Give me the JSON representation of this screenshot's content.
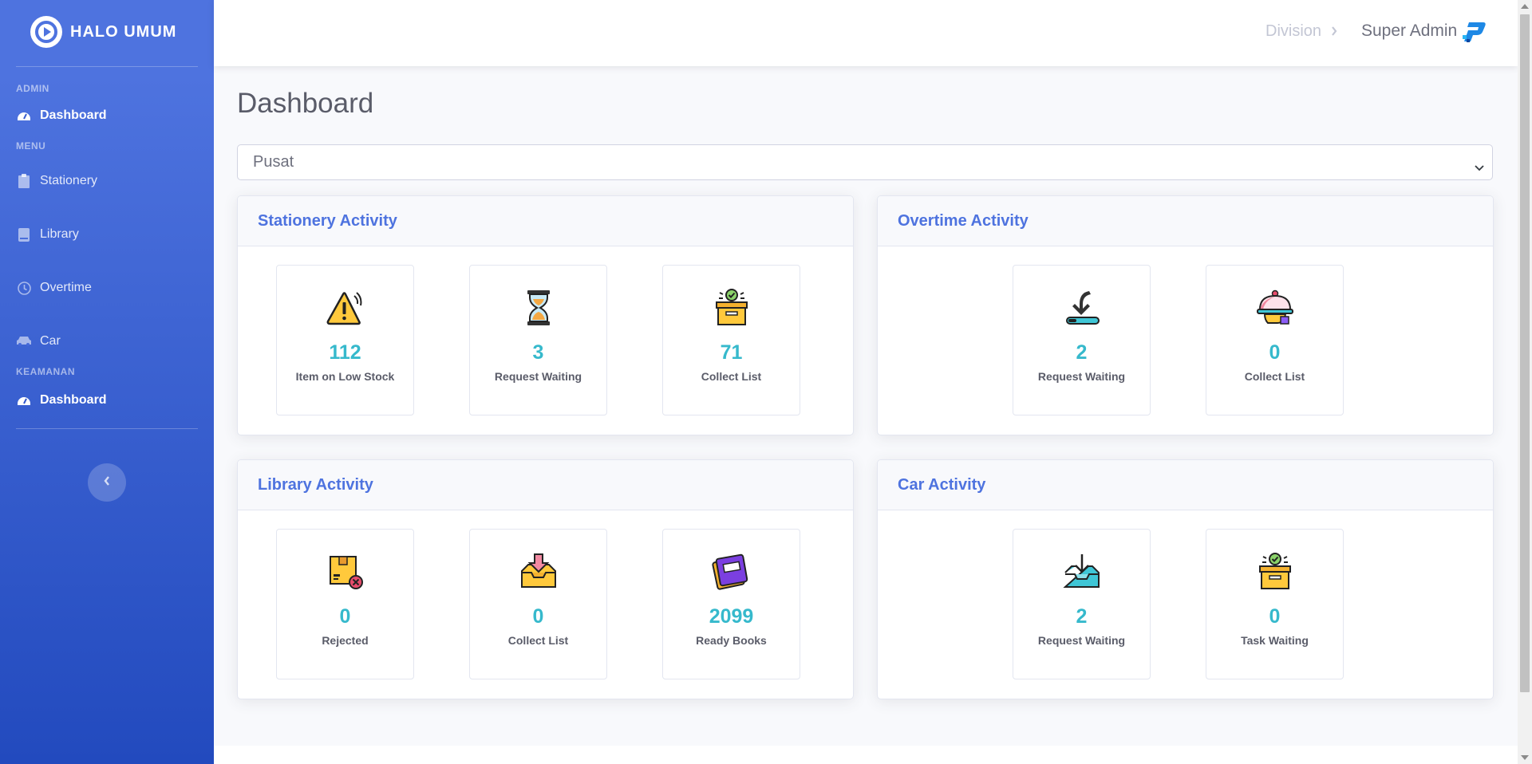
{
  "brand": {
    "name": "HALO UMUM"
  },
  "sidebar": {
    "sections": [
      "ADMIN",
      "MENU",
      "KEAMANAN"
    ],
    "items": [
      {
        "label": "Dashboard",
        "icon": "tachometer-icon"
      },
      {
        "label": "Stationery",
        "icon": "clipboard-icon"
      },
      {
        "label": "Library",
        "icon": "book-icon"
      },
      {
        "label": "Overtime",
        "icon": "clock-icon"
      },
      {
        "label": "Car",
        "icon": "car-icon"
      },
      {
        "label": "Dashboard",
        "icon": "tachometer-icon"
      }
    ],
    "toggle_icon": "chevron-left-icon"
  },
  "topbar": {
    "division": "Division",
    "user": "Super Admin"
  },
  "page": {
    "title": "Dashboard",
    "select_value": "Pusat"
  },
  "panels": {
    "stationery": {
      "title": "Stationery Activity",
      "tiles": [
        {
          "value": "112",
          "label": "Item on Low Stock",
          "icon": "warning-icon"
        },
        {
          "value": "3",
          "label": "Request Waiting",
          "icon": "hourglass-icon"
        },
        {
          "value": "71",
          "label": "Collect List",
          "icon": "box-check-icon"
        }
      ]
    },
    "overtime": {
      "title": "Overtime Activity",
      "tiles": [
        {
          "value": "2",
          "label": "Request Waiting",
          "icon": "download-arrow-icon"
        },
        {
          "value": "0",
          "label": "Collect List",
          "icon": "cloche-icon"
        }
      ]
    },
    "library": {
      "title": "Library Activity",
      "tiles": [
        {
          "value": "0",
          "label": "Rejected",
          "icon": "box-rejected-icon"
        },
        {
          "value": "0",
          "label": "Collect List",
          "icon": "inbox-down-icon"
        },
        {
          "value": "2099",
          "label": "Ready Books",
          "icon": "books-icon"
        }
      ]
    },
    "car": {
      "title": "Car Activity",
      "tiles": [
        {
          "value": "2",
          "label": "Request Waiting",
          "icon": "tray-download-icon"
        },
        {
          "value": "0",
          "label": "Task Waiting",
          "icon": "box-check-icon"
        }
      ]
    }
  },
  "colors": {
    "primary": "#4e73df",
    "primary_dark": "#224abe",
    "info": "#36b9cc"
  }
}
